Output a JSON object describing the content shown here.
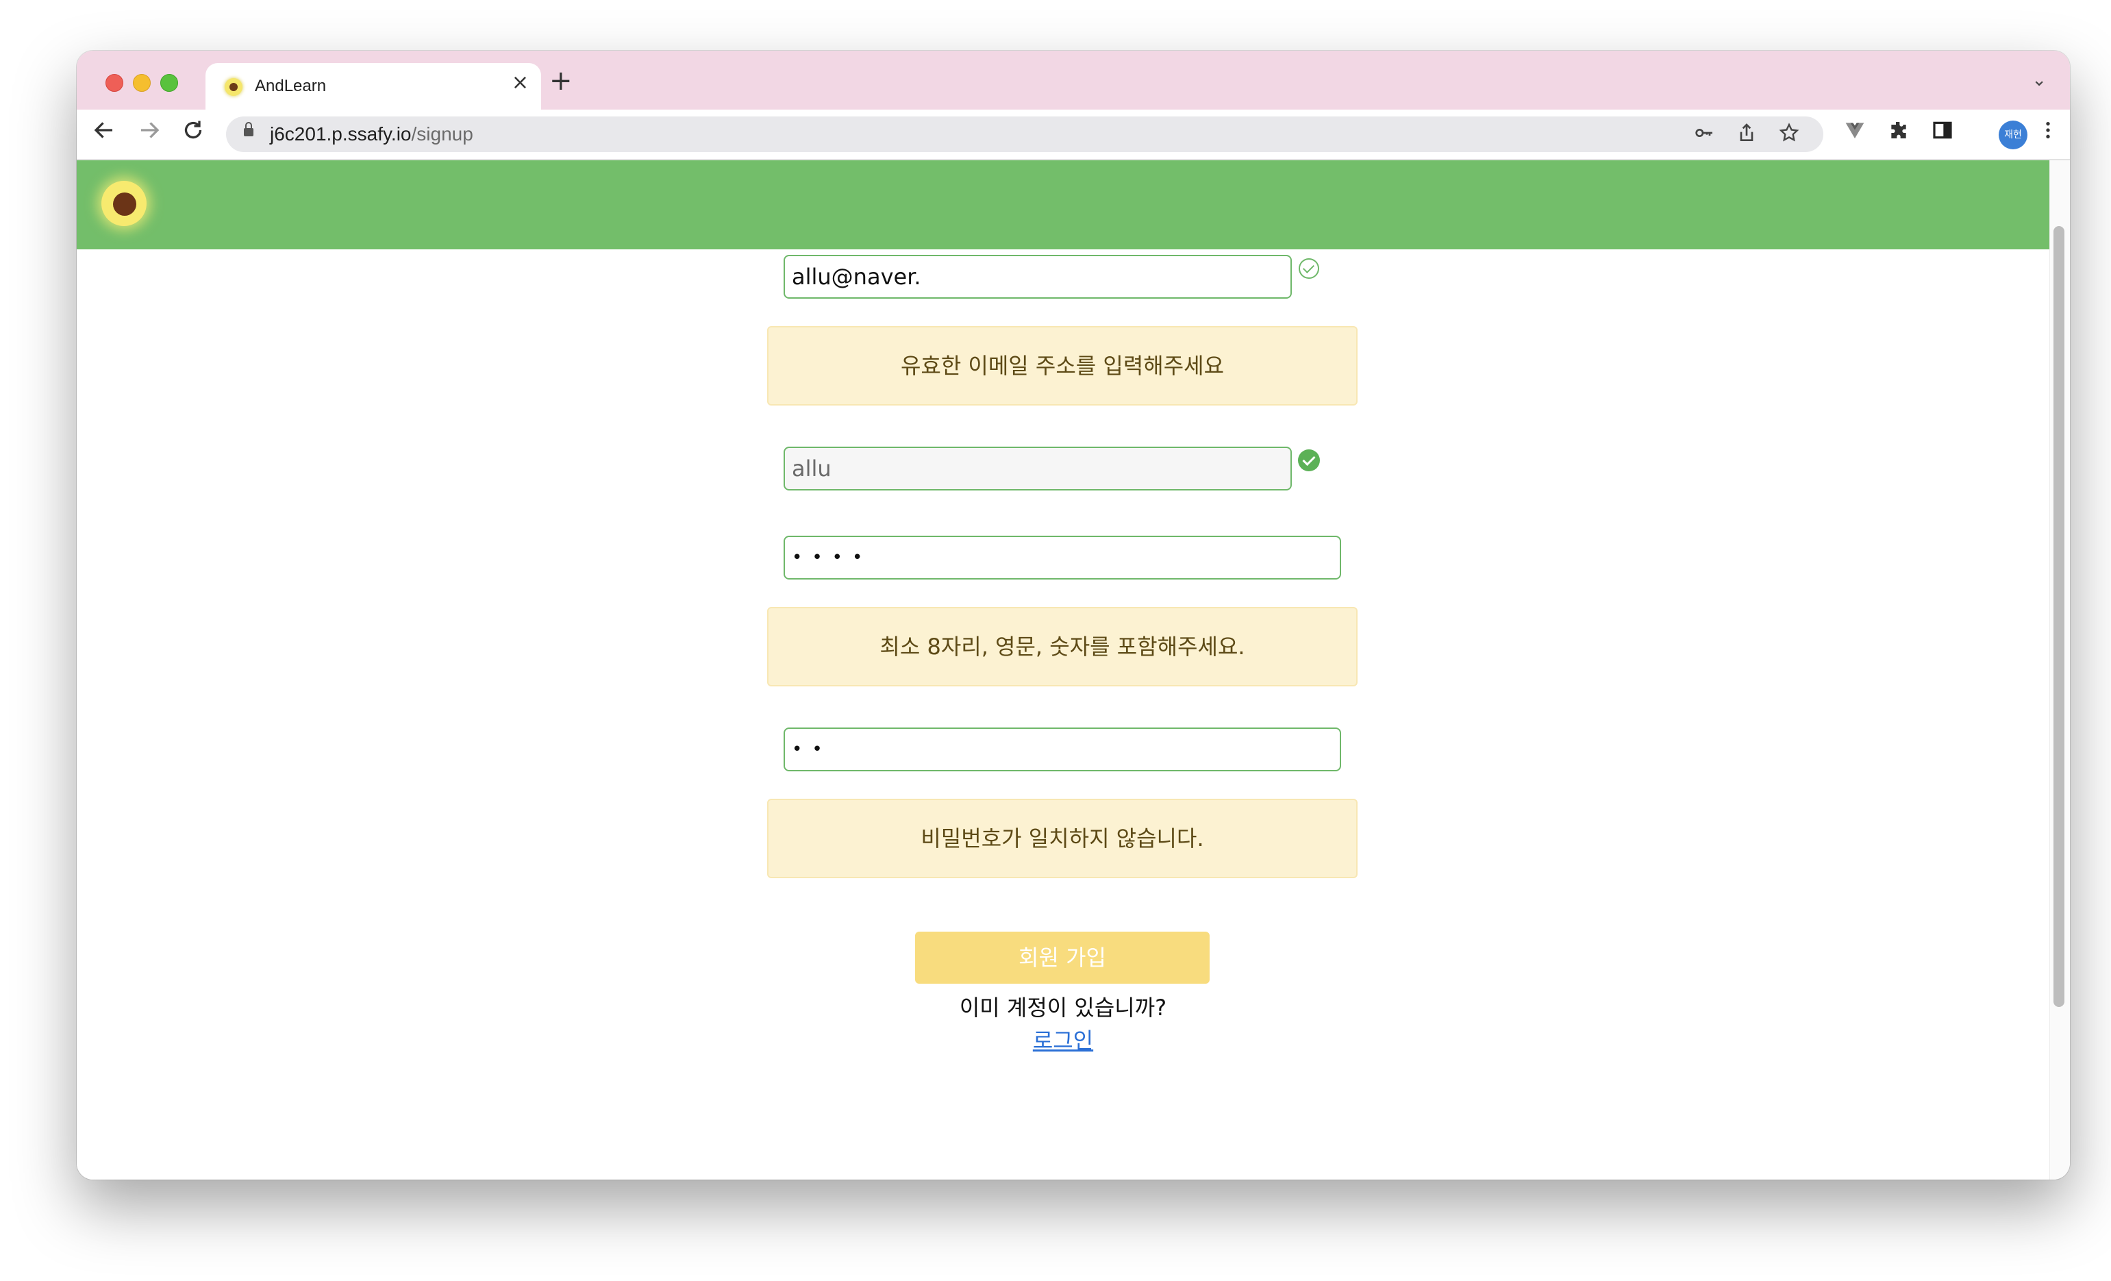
{
  "browser": {
    "tab_title": "AndLearn",
    "tab_close": "×",
    "new_tab": "+",
    "tab_list_icon": "⌄",
    "url_host": "j6c201.p.ssafy.io",
    "url_path": "/signup",
    "profile_label": "재현",
    "icons": [
      "back-icon",
      "forward-icon",
      "reload-icon",
      "lock-icon",
      "key-icon",
      "share-icon",
      "star-icon",
      "vue-devtools-icon",
      "extensions-icon",
      "side-panel-icon",
      "menu-icon"
    ]
  },
  "header": {
    "logo": "avocado-logo"
  },
  "form": {
    "email_value": "allu@naver.",
    "email_error": "유효한 이메일 주소를 입력해주세요",
    "nickname_value": "allu",
    "password_value": "••••",
    "password_error": "최소 8자리, 영문, 숫자를 포함해주세요.",
    "password_confirm_value": "••",
    "password_confirm_error": "비밀번호가 일치하지 않습니다.",
    "submit_label": "회원 가입",
    "login_prompt": "이미 계정이 있습니까?",
    "login_link": "로그인"
  },
  "colors": {
    "header_green": "#73be6a",
    "field_border": "#6fb86a",
    "alert_bg": "#fcf2d2",
    "button_bg": "#f8dc7e",
    "link": "#2a6fd6"
  }
}
